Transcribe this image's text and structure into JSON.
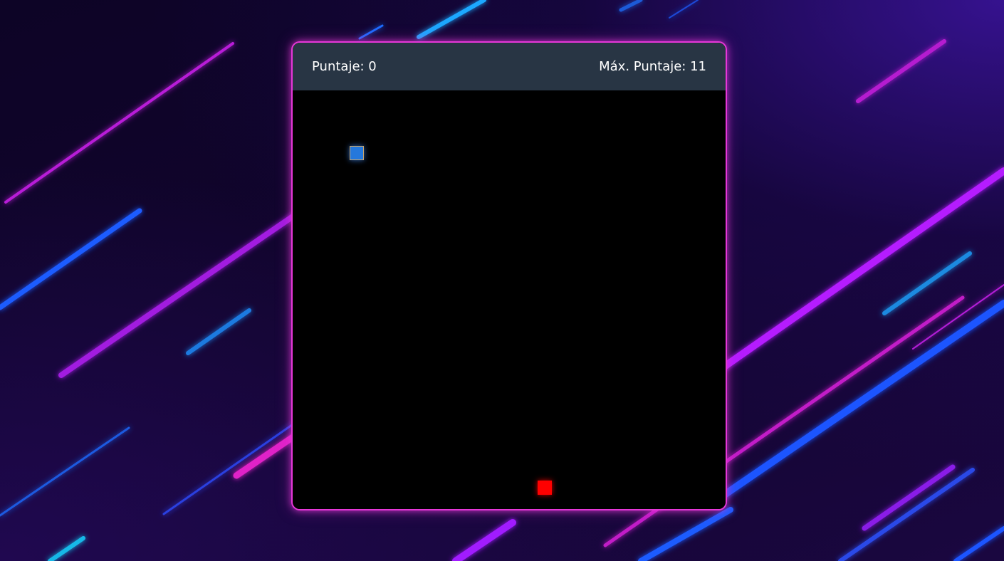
{
  "score": {
    "label": "Puntaje: 0",
    "value": 0
  },
  "high_score": {
    "label": "Máx. Puntaje: 11",
    "value": 11
  },
  "colors": {
    "board": "#000000",
    "frame_glow": "#e637d8",
    "score_bar": "#283544",
    "snake": "#2478dc",
    "food": "#ff0000"
  }
}
